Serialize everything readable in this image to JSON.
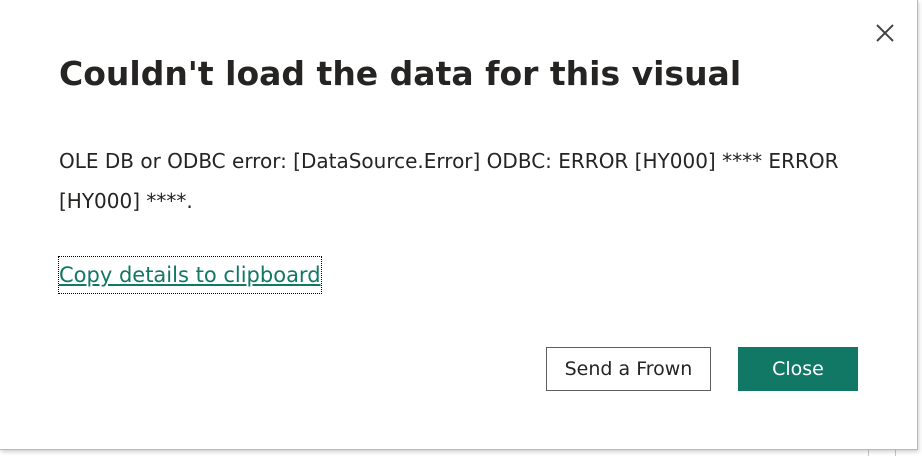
{
  "dialog": {
    "title": "Couldn't load the data for this visual",
    "message": "OLE DB or ODBC error: [DataSource.Error] ODBC: ERROR [HY000] **** ERROR [HY000] ****.",
    "copy_link_label": "Copy details to clipboard",
    "buttons": {
      "send_frown_label": "Send a Frown",
      "close_label": "Close"
    },
    "close_icon": "close-icon"
  },
  "colors": {
    "accent": "#117865",
    "title_text": "#252423",
    "secondary_border": "#605e5c"
  }
}
